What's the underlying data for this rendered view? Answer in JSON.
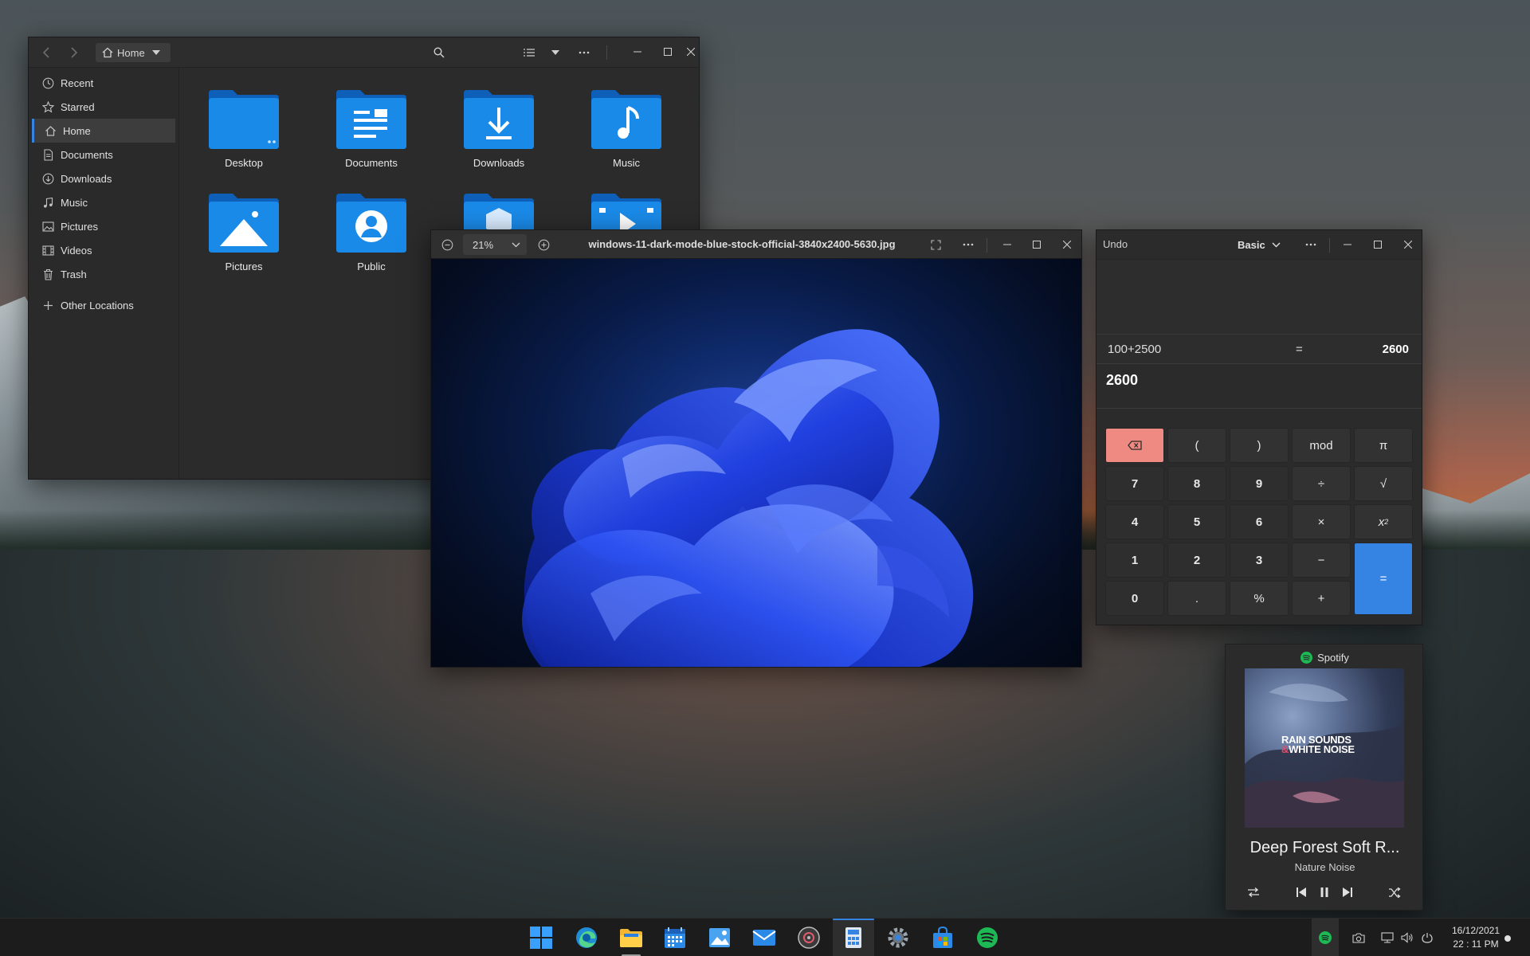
{
  "files": {
    "breadcrumb": "Home",
    "sidebar": [
      {
        "label": "Recent",
        "icon": "clock-icon"
      },
      {
        "label": "Starred",
        "icon": "star-icon"
      },
      {
        "label": "Home",
        "icon": "home-icon",
        "active": true
      },
      {
        "label": "Documents",
        "icon": "document-icon"
      },
      {
        "label": "Downloads",
        "icon": "download-icon"
      },
      {
        "label": "Music",
        "icon": "music-icon"
      },
      {
        "label": "Pictures",
        "icon": "image-icon"
      },
      {
        "label": "Videos",
        "icon": "video-icon"
      },
      {
        "label": "Trash",
        "icon": "trash-icon"
      }
    ],
    "other_locations": "Other Locations",
    "folders": [
      "Desktop",
      "Documents",
      "Downloads",
      "Music",
      "Pictures",
      "Public"
    ]
  },
  "viewer": {
    "zoom": "21%",
    "filename": "windows-11-dark-mode-blue-stock-official-3840x2400-5630.jpg"
  },
  "calc": {
    "undo": "Undo",
    "mode": "Basic",
    "expression": "100+2500",
    "equals": "=",
    "result_inline": "2600",
    "result": "2600",
    "keys": {
      "lparen": "(",
      "rparen": ")",
      "mod": "mod",
      "pi": "π",
      "k7": "7",
      "k8": "8",
      "k9": "9",
      "div": "÷",
      "sqrt": "√",
      "k4": "4",
      "k5": "5",
      "k6": "6",
      "mul": "×",
      "sq_base": "x",
      "sq_exp": "2",
      "k1": "1",
      "k2": "2",
      "k3": "3",
      "minus": "−",
      "k0": "0",
      "dot": ".",
      "pct": "%",
      "plus": "+",
      "eq": "="
    }
  },
  "spotify": {
    "app": "Spotify",
    "art_line1": "RAIN SOUNDS",
    "art_amp": "&",
    "art_line2": "WHITE NOISE",
    "track": "Deep Forest Soft R...",
    "artist": "Nature Noise"
  },
  "taskbar": {
    "date": "16/12/2021",
    "time": "22 : 11 PM"
  },
  "colors": {
    "accent": "#3584e4",
    "delete_key": "#ef8a82",
    "spotify_green": "#1db954"
  }
}
